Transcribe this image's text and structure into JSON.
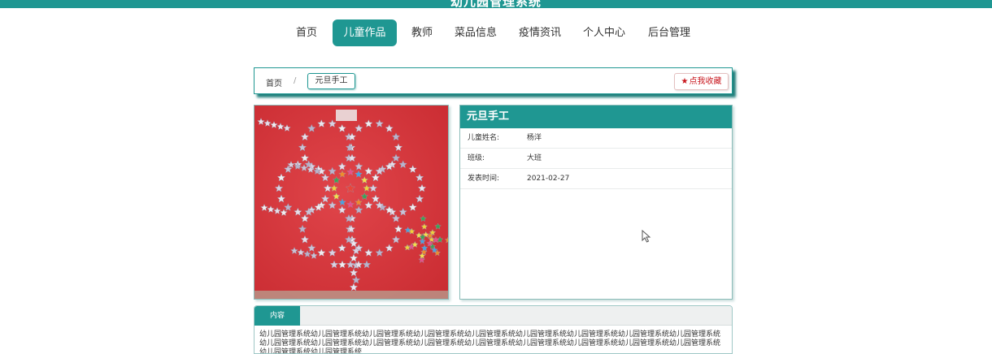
{
  "header": {
    "title": "幼儿园管理系统"
  },
  "nav": {
    "items": [
      {
        "label": "首页"
      },
      {
        "label": "儿童作品"
      },
      {
        "label": "教师"
      },
      {
        "label": "菜品信息"
      },
      {
        "label": "疫情资讯"
      },
      {
        "label": "个人中心"
      },
      {
        "label": "后台管理"
      }
    ],
    "active_index": 1
  },
  "breadcrumb": {
    "home": "首页",
    "separator": "/",
    "current": "元旦手工"
  },
  "favorite": {
    "icon": "star-icon",
    "label": "点我收藏"
  },
  "detail": {
    "title": "元旦手工",
    "rows": [
      {
        "label": "儿童姓名:",
        "value": "杨洋"
      },
      {
        "label": "班级:",
        "value": "大班"
      },
      {
        "label": "发表时间:",
        "value": "2021-02-27"
      }
    ]
  },
  "content": {
    "tab_label": "内容",
    "text": "幼儿园管理系统幼儿园管理系统幼儿园管理系统幼儿园管理系统幼儿园管理系统幼儿园管理系统幼儿园管理系统幼儿园管理系统幼儿园管理系统幼儿园管理系统幼儿园管理系统幼儿园管理系统幼儿园管理系统幼儿园管理系统幼儿园管理系统幼儿园管理系统幼儿园管理系统幼儿园管理系统幼儿园管理系统幼儿园管理系统"
  },
  "colors": {
    "primary": "#1f9792",
    "favorite": "#c8161d",
    "photo_background": "#d8353a"
  }
}
